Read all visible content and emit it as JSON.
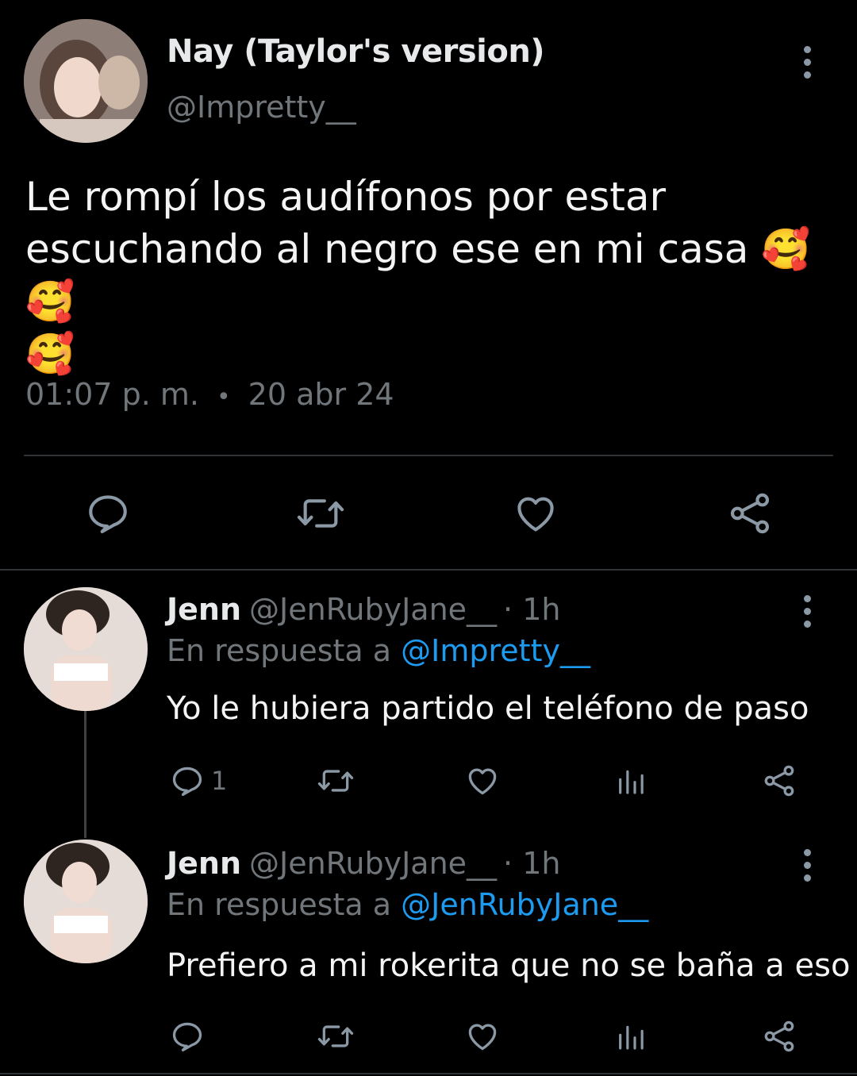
{
  "tweet": {
    "author": {
      "name": "Nay (Taylor's version)",
      "handle": "@Impretty__"
    },
    "text_line1": "Le rompí los audífonos por estar",
    "text_line2": "escuchando al negro ese en mi casa",
    "emojis_line2": "🥰🥰",
    "emojis_line3": "🥰",
    "time": "01:07 p. m.",
    "separator": "•",
    "date": "20 abr 24",
    "actions": [
      "reply-icon",
      "retweet-icon",
      "like-icon",
      "share-icon"
    ]
  },
  "replies": [
    {
      "name": "Jenn",
      "handle": "@JenRubyJane__",
      "age": "· 1h",
      "reply_prefix": "En respuesta a",
      "reply_to": "@Impretty__",
      "text": "Yo le hubiera partido el teléfono de paso",
      "reply_count": "1"
    },
    {
      "name": "Jenn",
      "handle": "@JenRubyJane__",
      "age": "· 1h",
      "reply_prefix": "En respuesta a",
      "reply_to": "@JenRubyJane__",
      "text": "Prefiero a mi rokerita que no se baña a eso",
      "reply_count": ""
    }
  ],
  "colors": {
    "background": "#000000",
    "text": "#e7e9ea",
    "muted": "#71767b",
    "link": "#1d9bf0",
    "divider": "#2f3336"
  }
}
